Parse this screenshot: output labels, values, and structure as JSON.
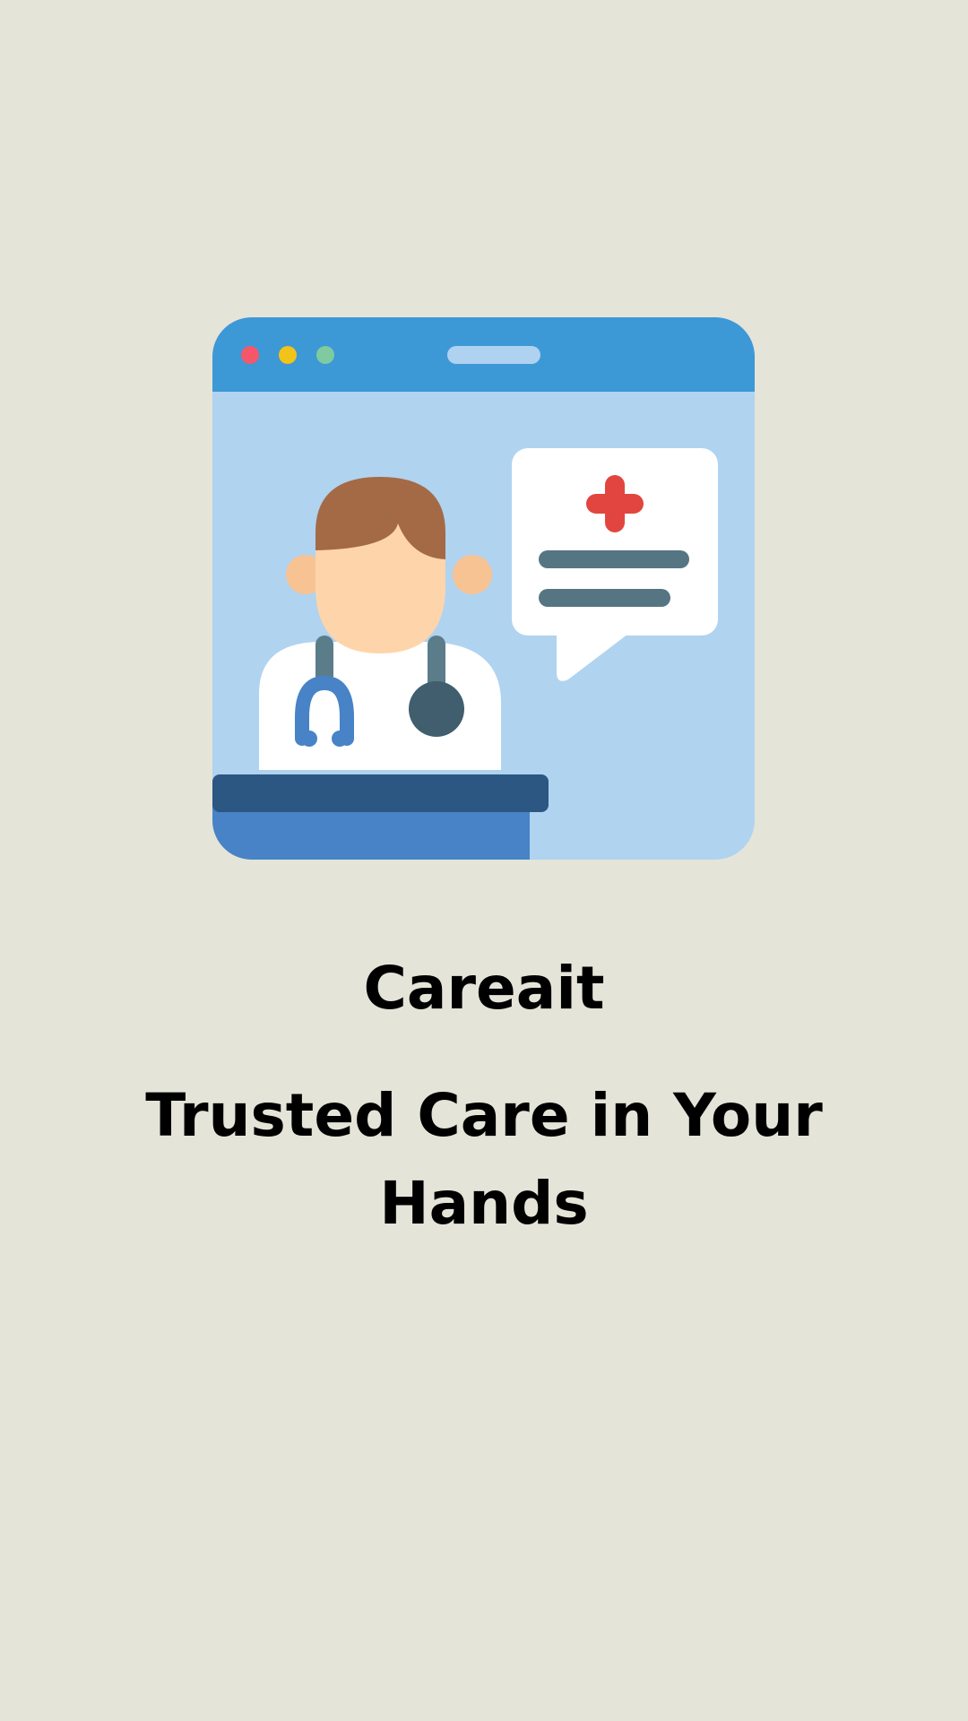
{
  "splash": {
    "app_name": "Careait",
    "tagline": "Trusted Care in Your Hands"
  },
  "colors": {
    "background": "#E4E4D8",
    "window_bar": "#3D98D6",
    "window_body": "#B0D3F0",
    "desk_top": "#2C5782",
    "desk_front": "#4783C6",
    "medical_cross": "#E2453F",
    "text": "#000000"
  },
  "icons": {
    "illustration": "telemedicine-doctor-icon",
    "chat": "chat-bubble-icon",
    "cross": "medical-cross-icon",
    "stethoscope": "stethoscope-icon"
  }
}
